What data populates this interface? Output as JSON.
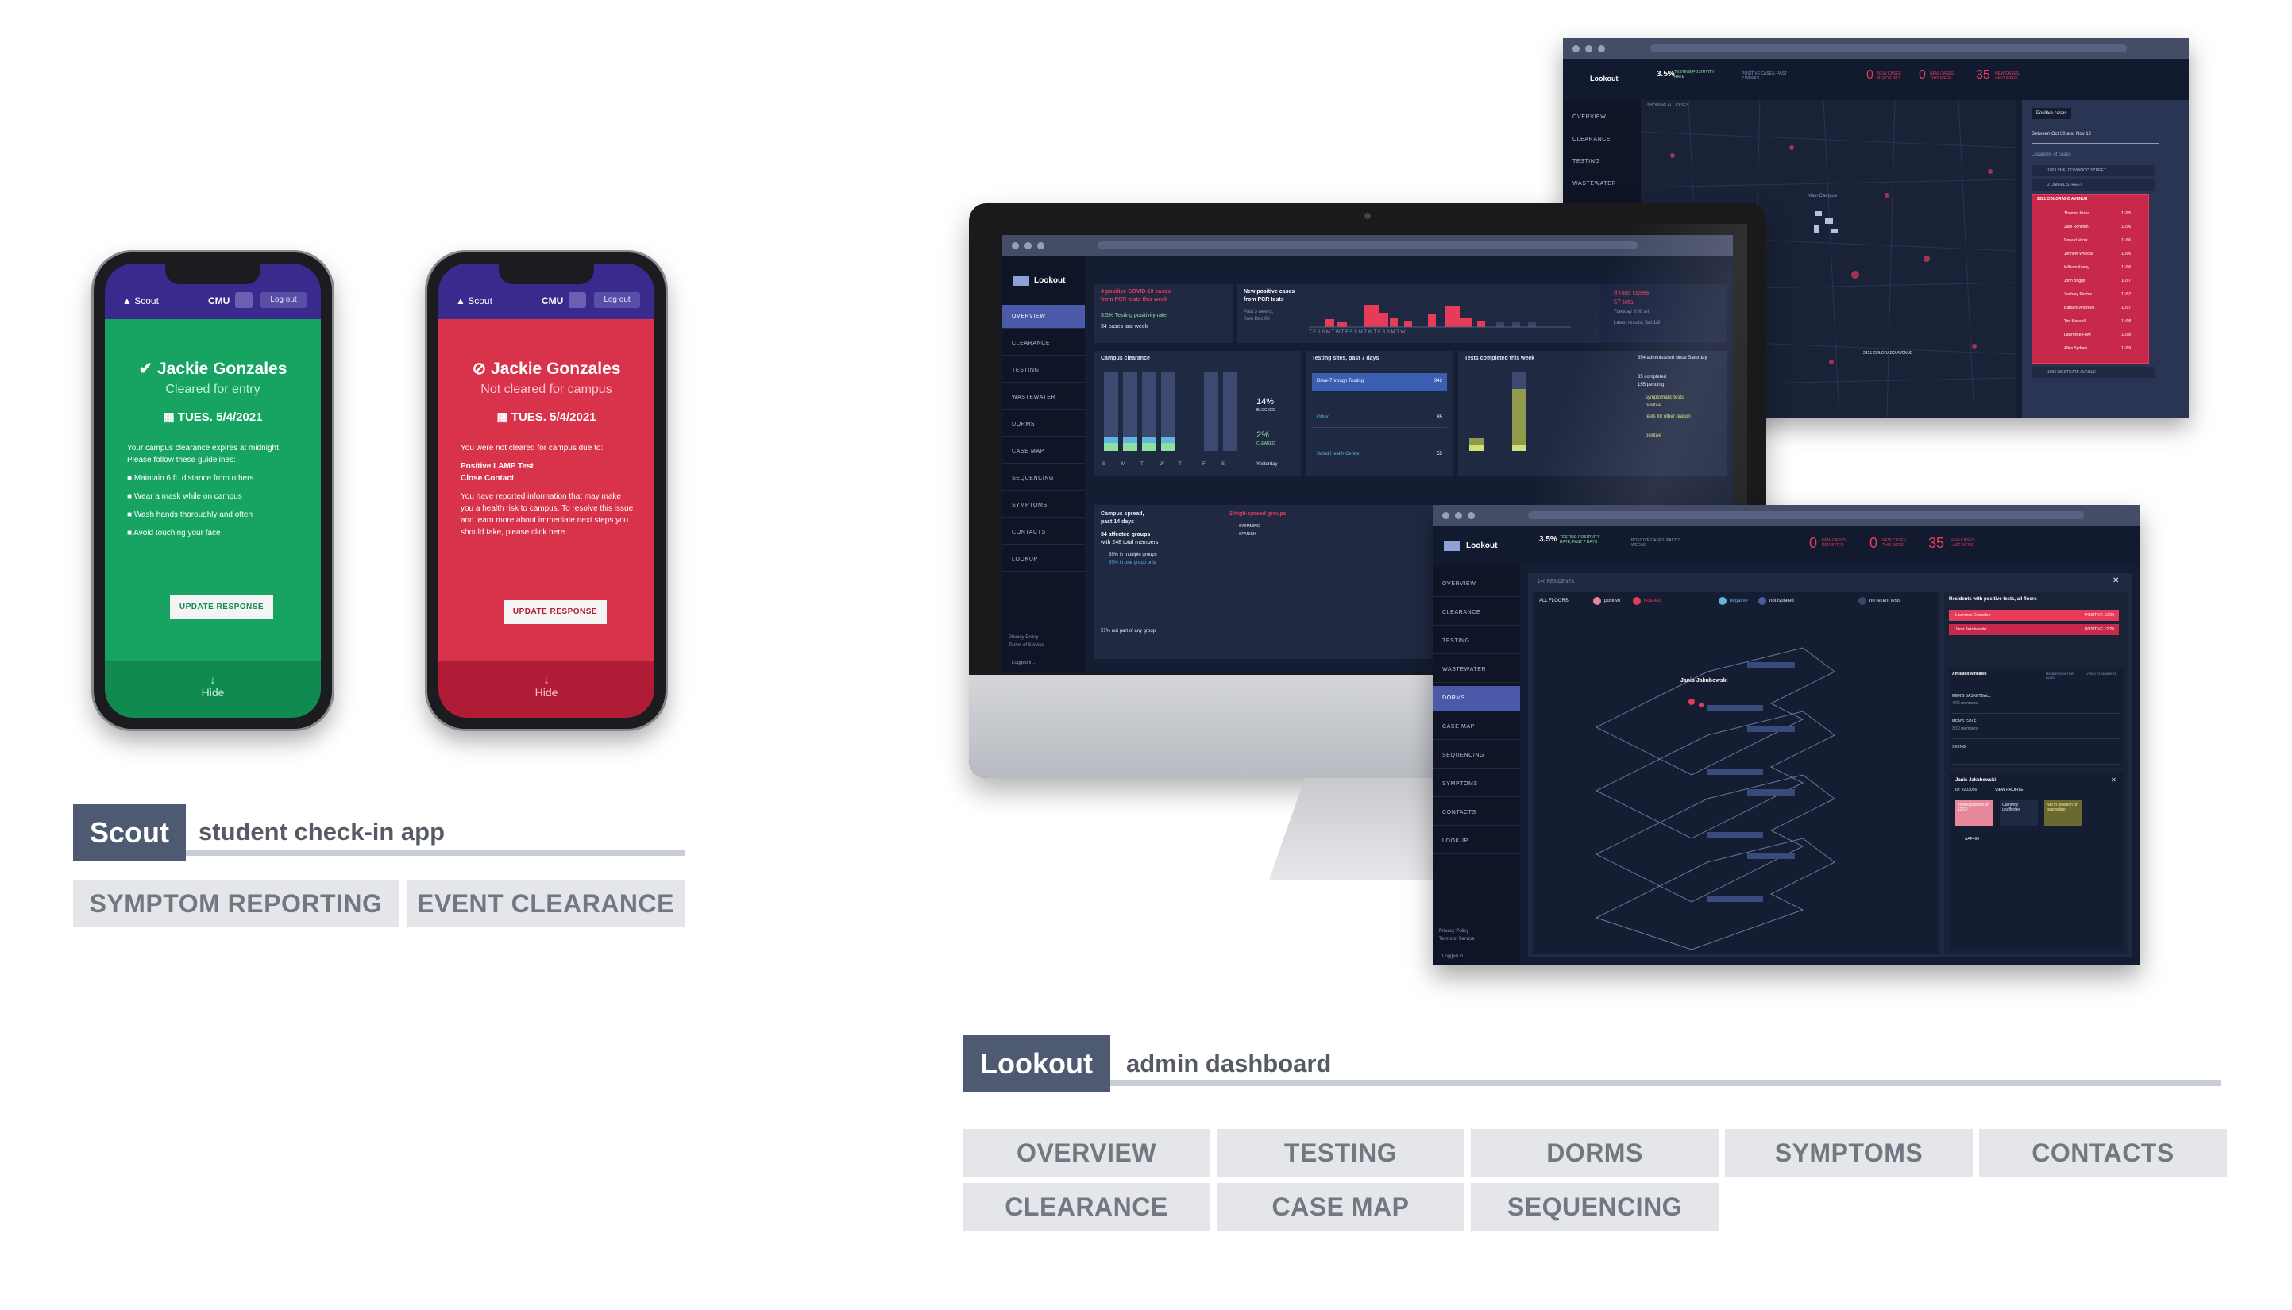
{
  "scout_phone_green": {
    "brand": "Scout",
    "org": "CMU",
    "logout": "Log out",
    "name": "Jackie Gonzales",
    "status": "Cleared for entry",
    "date": "TUES. 5/4/2021",
    "lines": [
      "Your campus clearance expires at midnight. Please follow these guidelines:",
      "Maintain 6 ft. distance from others",
      "Wear a mask while on campus",
      "Wash hands thoroughly and often",
      "Avoid touching your face"
    ],
    "button": "UPDATE RESPONSE",
    "hide": "Hide",
    "colors": {
      "body": "#17a463",
      "foot": "#118a52",
      "accent": "#bff5d6"
    }
  },
  "scout_phone_red": {
    "brand": "Scout",
    "org": "CMU",
    "logout": "Log out",
    "name": "Jackie Gonzales",
    "status": "Not cleared for campus",
    "date": "TUES. 5/4/2021",
    "lines": [
      "You were not cleared for campus due to:",
      "Positive LAMP Test",
      "Close Contact",
      "You have reported information that may make you a health risk to campus. To resolve this issue and learn more about immediate next steps you should take, please click here."
    ],
    "button": "UPDATE RESPONSE",
    "hide": "Hide",
    "colors": {
      "body": "#d8334b",
      "foot": "#b01c35",
      "accent": "#ffc7d0"
    }
  },
  "scout_label": {
    "title": "Scout",
    "subtitle": "student check-in app"
  },
  "scout_chips": [
    "SYMPTOM REPORTING",
    "EVENT CLEARANCE"
  ],
  "lookout_nav": [
    "OVERVIEW",
    "CLEARANCE",
    "TESTING",
    "WASTEWATER",
    "DORMS",
    "CASE MAP",
    "SEQUENCING",
    "SYMPTOMS",
    "CONTACTS",
    "LOOKUP"
  ],
  "lookout_footer": [
    "Privacy Policy",
    "Terms of Service",
    "Logged in...",
    "test.user"
  ],
  "overview": {
    "brand": "Lookout",
    "card1_line1": "4 positive COVID-19 cases",
    "card1_line2": "from PCR tests this week",
    "card1_line3": "3.5% Testing positivity rate",
    "card1_line4": "34 cases last week",
    "card2_line1": "New positive cases",
    "card2_line2": "from PCR tests",
    "card2_line3": "Past 3 weeks,",
    "card2_line4": "from Dec 08",
    "card3_line1": "0 new cases",
    "card3_line2": "57 total",
    "card3_line3": "Tuesday 9:00 am",
    "card3_line4": "Latest results, Sat 1/9",
    "clearance_title": "Campus clearance",
    "clearance_pct1": "14%",
    "clearance_lbl1": "BLOCKED",
    "clearance_pct2": "2%",
    "clearance_lbl2": "CLEARED",
    "clearance_footer": "Yesterday",
    "days": [
      "S",
      "M",
      "T",
      "W",
      "T",
      "F",
      "S"
    ],
    "sites_title": "Testing sites, past 7 days",
    "sites": [
      {
        "name": "Drive-Through Testing",
        "value": "942"
      },
      {
        "name": "Other",
        "value": "85"
      },
      {
        "name": "Salud Health Center",
        "value": "55"
      }
    ],
    "completed_title": "Tests completed this week",
    "completed_stats": [
      "354 administered since Saturday",
      "35 completed",
      "155 pending"
    ],
    "completed_legend": [
      "symptomatic tests",
      "positive",
      "tests for other reason",
      "positive"
    ],
    "spread_title": "Campus spread,",
    "spread_sub": "past 14 days",
    "spread_groups": "34 affected groups",
    "spread_members": "with 248 total members",
    "spread_multi": "35% in multiple groups",
    "spread_one": "65% in one group only",
    "spread_none": "57% not part of any group",
    "highrisk_title": "2 high-spread groups",
    "highrisk_items": [
      "SWIMMING",
      "SPANISH"
    ]
  },
  "casemap": {
    "brand": "Lookout",
    "stat1": "3.5%",
    "stat1_lbl": "TESTING POSITIVITY RATE",
    "stat2_lbl": "POSITIVE CASES, PAST 2 WEEKS",
    "counters": [
      {
        "value": "0",
        "label": "NEW CASES REPORTED"
      },
      {
        "value": "0",
        "label": "NEW CASES, THIS WEEK"
      },
      {
        "value": "35",
        "label": "NEW CASES, LAST WEEK"
      }
    ],
    "map_labels": [
      "Main Campus",
      "2321 COLORADO AVENUE",
      "SHOWING ALL CASES"
    ],
    "panel_btn": "Positive cases",
    "panel_range": "Between Oct 30 and Nov 12",
    "panel_sub": "Locations of cases",
    "locations": [
      "1003 SHELDONWOOD STREET",
      "2 DAMIEL STREET",
      "2321 COLORADO AVENUE",
      "1005 WESTGATE AVENUE"
    ],
    "people": [
      {
        "name": "Thomas Nixon",
        "date": "11/05"
      },
      {
        "name": "Julie Rohman",
        "date": "11/06"
      },
      {
        "name": "Donald Vonix",
        "date": "11/06"
      },
      {
        "name": "Jennifer Woodall",
        "date": "11/06"
      },
      {
        "name": "William Kenny",
        "date": "11/06"
      },
      {
        "name": "John Briggs",
        "date": "11/07"
      },
      {
        "name": "Zachary Pirates",
        "date": "11/07"
      },
      {
        "name": "Barbara Andrews",
        "date": "11/07"
      },
      {
        "name": "Tim Mansell",
        "date": "11/08"
      },
      {
        "name": "Lawrence Fowl",
        "date": "11/08"
      },
      {
        "name": "Allen Sydney",
        "date": "11/09"
      }
    ]
  },
  "dorms": {
    "brand": "Lookout",
    "stat1": "3.5%",
    "stat1_lbl": "TESTING POSITIVITY RATE, PAST 7 DAYS",
    "stat2_lbl": "POSITIVE CASES, PAST 2 WEEKS",
    "counters": [
      {
        "value": "0",
        "label": "NEW CASES REPORTED"
      },
      {
        "value": "0",
        "label": "NEW CASES, THIS WEEK"
      },
      {
        "value": "35",
        "label": "NEW CASES, LAST WEEK"
      }
    ],
    "residents": "140 RESIDENTS",
    "legend": [
      "ALL FLOORS",
      "positive",
      "isolated",
      "negative",
      "not isolated",
      "no recent tests"
    ],
    "person_tag": "Janis Jakubowski",
    "right_title": "Residents with positive tests, all floors",
    "positive_rows": [
      {
        "name": "Lawrence Gonzales",
        "status": "POSITIVE 12/20"
      },
      {
        "name": "Janis Jakubowski",
        "status": "POSITIVE 12/20"
      }
    ],
    "affil_headers": [
      "Affiliated Affiliates",
      "MEMBERS IN THIS BLDG",
      "LIVING ELSEWHERE"
    ],
    "affil_rows": [
      "MEN'S BASKETBALL",
      "MEN'S GOLF",
      "SKIING"
    ],
    "affil_members": [
      "4/26 members",
      "3/10 members",
      ""
    ],
    "profile_name": "Janis Jakubowski",
    "profile_links": [
      "ID: #203056",
      "VIEW PROFILE"
    ],
    "profile_cards": [
      "Tested positive on 12/20",
      "Currently unaffected",
      "Not in isolation or quarantine"
    ],
    "profile_code": "AAF490"
  },
  "lookout_label": {
    "title": "Lookout",
    "subtitle": "admin dashboard"
  },
  "lookout_chips": [
    "OVERVIEW",
    "TESTING",
    "DORMS",
    "SYMPTOMS",
    "CONTACTS",
    "CLEARANCE",
    "CASE MAP",
    "SEQUENCING"
  ]
}
